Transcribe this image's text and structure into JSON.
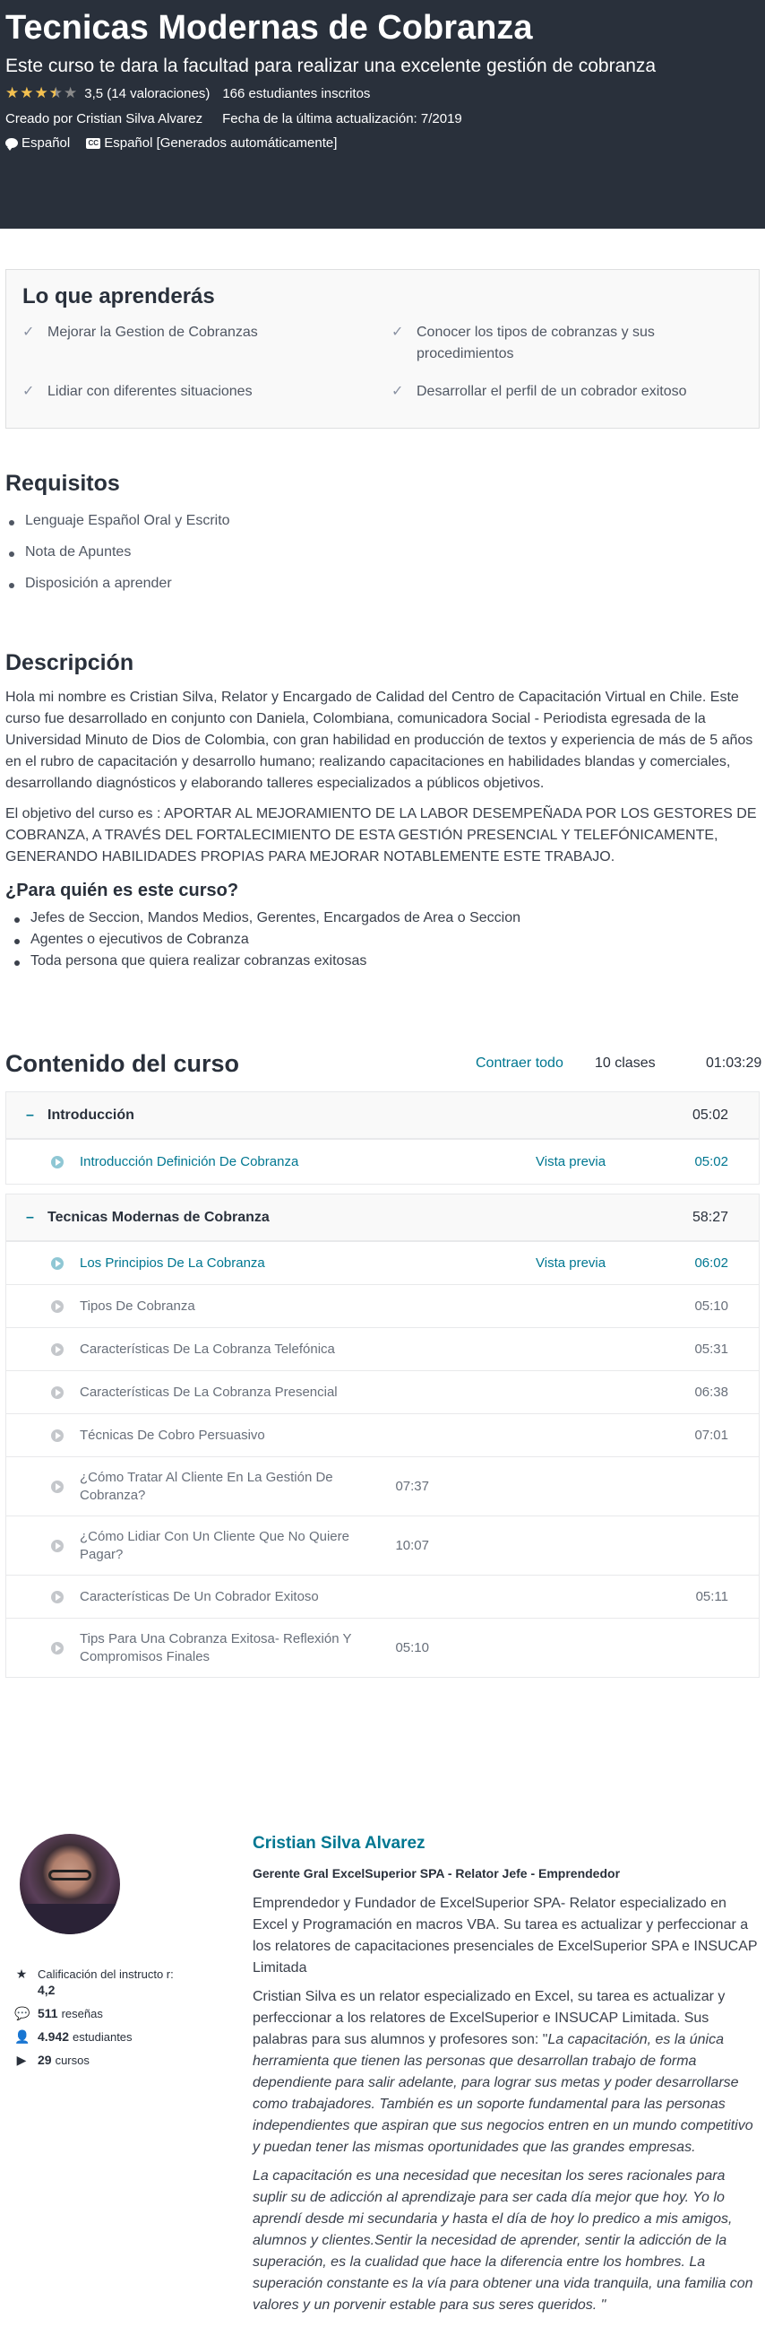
{
  "header": {
    "title": "Tecnicas Modernas de Cobranza",
    "subtitle": "Este curso te dara la facultad para realizar una excelente gestión de cobranza",
    "rating": 3.5,
    "rating_text": "3,5 (14 valoraciones)",
    "students": "166 estudiantes inscritos",
    "created_by": "Creado por Cristian Silva Alvarez",
    "updated": "Fecha de la última actualización: 7/2019",
    "language": "Español",
    "captions": "Español [Generados automáticamente]",
    "star_color": "#f4c150",
    "background": "#29303b"
  },
  "learn": {
    "title": "Lo que aprenderás",
    "items": [
      "Mejorar la Gestion de Cobranzas",
      "Conocer los tipos de cobranzas y sus procedimientos",
      "Lidiar con diferentes situaciones",
      "Desarrollar el perfil de un cobrador exitoso"
    ]
  },
  "requirements": {
    "title": "Requisitos",
    "items": [
      "Lenguaje Español Oral y Escrito",
      "Nota de Apuntes",
      "Disposición a aprender"
    ]
  },
  "description": {
    "title": "Descripción",
    "paragraphs": [
      "Hola mi nombre es Cristian Silva, Relator y Encargado de Calidad del Centro de Capacitación Virtual en Chile. Este curso fue desarrollado en conjunto con Daniela, Colombiana, comunicadora Social - Periodista egresada de la Universidad Minuto de Dios de Colombia, con gran habilidad en producción de textos y experiencia de más de 5 años en el rubro de capacitación y desarrollo humano; realizando capacitaciones en habilidades blandas y comerciales, desarrollando diagnósticos y elaborando talleres especializados a públicos objetivos.",
      "El objetivo del curso es : APORTAR AL MEJORAMIENTO DE LA LABOR DESEMPEÑADA POR LOS GESTORES DE COBRANZA, A TRAVÉS DEL FORTALECIMIENTO DE ESTA GESTIÓN PRESENCIAL Y TELEFÓNICAMENTE, GENERANDO HABILIDADES PROPIAS PARA MEJORAR NOTABLEMENTE ESTE TRABAJO."
    ],
    "audience_title": "¿Para quién es este curso?",
    "audience": [
      "Jefes de Seccion, Mandos Medios, Gerentes, Encargados de Area o Seccion",
      "Agentes o ejecutivos de Cobranza",
      "Toda persona que quiera realizar cobranzas exitosas"
    ]
  },
  "content": {
    "title": "Contenido del curso",
    "collapse_label": "Contraer todo",
    "lecture_count": "10 clases",
    "total_duration": "01:03:29",
    "accent": "#007791",
    "sections": [
      {
        "title": "Introducción",
        "duration": "05:02",
        "lectures": [
          {
            "title": "Introducción Definición De Cobranza",
            "preview": "Vista previa",
            "duration": "05:02"
          }
        ]
      },
      {
        "title": "Tecnicas Modernas de Cobranza",
        "duration": "58:27",
        "lectures": [
          {
            "title": "Los Principios De La Cobranza",
            "preview": "Vista previa",
            "duration": "06:02"
          },
          {
            "title": "Tipos De Cobranza",
            "duration": "05:10"
          },
          {
            "title": "Características De La Cobranza Telefónica",
            "duration": "05:31"
          },
          {
            "title": "Características De La Cobranza Presencial",
            "duration": "06:38"
          },
          {
            "title": "Técnicas De Cobro Persuasivo",
            "duration": "07:01"
          },
          {
            "title": "¿Cómo Tratar Al Cliente En La Gestión De Cobranza?",
            "duration": "07:37"
          },
          {
            "title": "¿Cómo Lidiar Con Un Cliente Que No Quiere Pagar?",
            "duration": "10:07"
          },
          {
            "title": "Características De Un Cobrador Exitoso",
            "duration": "05:11"
          },
          {
            "title": "Tips Para Una Cobranza Exitosa- Reflexión Y Compromisos Finales",
            "duration": "05:10"
          }
        ]
      }
    ]
  },
  "instructor": {
    "name": "Cristian Silva Alvarez",
    "job_title": "Gerente Gral ExcelSuperior SPA - Relator Jefe - Emprendedor",
    "rating_label": "Calificación del instructo r:",
    "rating_value": "4,2",
    "reviews_value": "511",
    "reviews_label": "reseñas",
    "students_value": "4.942",
    "students_label": "estudiantes",
    "courses_value": "29",
    "courses_label": "cursos",
    "bio_1": "Emprendedor y Fundador de ExcelSuperior SPA- Relator especializado en Excel y Programación en macros VBA. Su tarea es actualizar y perfeccionar a los relatores de capacitaciones presenciales de ExcelSuperior  SPA e INSUCAP Limitada",
    "bio_2_intro": "Cristian Silva es un relator especializado en Excel, su tarea es actualizar y perfeccionar a los relatores de ExcelSuperior e INSUCAP Limitada. Sus palabras para sus alumnos y profesores son: \"",
    "bio_2_quote": "La capacitación, es la única herramienta que tienen las personas que desarrollan trabajo de forma dependiente para salir adelante, para lograr sus metas y poder desarrollarse como trabajadores. También es un soporte fundamental para las personas independientes que aspiran que sus negocios entren en un mundo competitivo y puedan tener las mismas oportunidades que las grandes empresas.",
    "bio_3": "La capacitación es una necesidad que necesitan los seres racionales para suplir su de adicción al aprendizaje para ser cada día mejor que hoy. Yo lo aprendí desde mi secundaria y hasta el día de hoy lo predico a mis amigos, alumnos y clientes.Sentir la necesidad de aprender, sentir la adicción de la superación, es la cualidad que hace la diferencia entre los hombres. La superación constante es la vía para obtener una vida tranquila, una familia con valores y un porvenir estable para sus seres queridos. \""
  }
}
